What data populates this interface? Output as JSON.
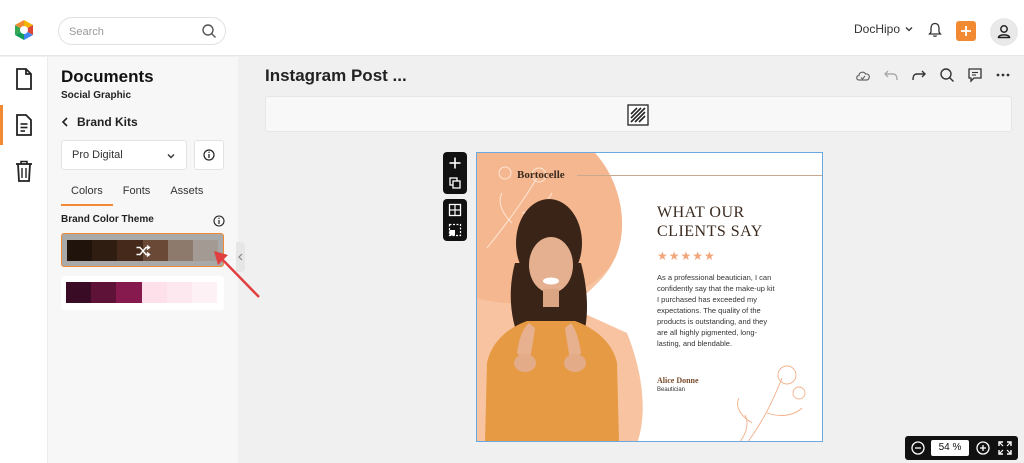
{
  "topbar": {
    "search_placeholder": "Search",
    "account_name": "DocHipo",
    "accent_color": "#f28a33"
  },
  "rail": {
    "items": [
      {
        "icon": "document-icon"
      },
      {
        "icon": "doc-list-icon",
        "active": true
      },
      {
        "icon": "trash-icon"
      }
    ]
  },
  "panel": {
    "title": "Documents",
    "subtitle": "Social Graphic",
    "back_label": "Brand Kits",
    "kit_selected": "Pro Digital",
    "tabs": [
      "Colors",
      "Fonts",
      "Assets"
    ],
    "active_tab": "Colors",
    "theme_label": "Brand Color Theme",
    "themes": [
      {
        "colors": [
          "#1f130c",
          "#2f1d12",
          "#45291a",
          "#6a4a36",
          "#8e7a6c",
          "#a39a93"
        ],
        "selected": true
      },
      {
        "colors": [
          "#3a0b24",
          "#5e1238",
          "#861a4e",
          "#fde0ea",
          "#fde8f0",
          "#fef1f6"
        ],
        "selected": false
      }
    ]
  },
  "workspace": {
    "doc_title": "Instagram Post ...",
    "zoom_value": "54",
    "zoom_unit": "%"
  },
  "canvas": {
    "brand": "Bortocelle",
    "heading_line1": "WHAT OUR",
    "heading_line2": "CLIENTS SAY",
    "stars": "★★★★★",
    "rating": 5,
    "quote": "As a professional beautician, I can confidently say that the make-up kit I purchased has exceeded my expectations. The quality of the products is outstanding, and they are all highly pigmented, long-lasting, and blendable.",
    "author_name": "Alice Donne",
    "author_role": "Beautician"
  }
}
